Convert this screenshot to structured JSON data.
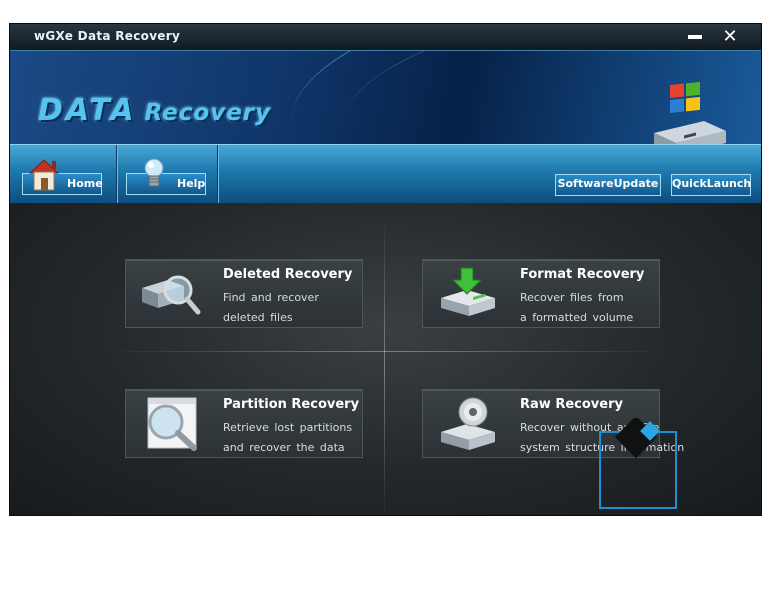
{
  "window": {
    "title": "wGXe Data Recovery",
    "minimize_icon": "minimize-icon",
    "close_icon": "close-icon",
    "close_glyph": "✕"
  },
  "banner": {
    "logo_part1": "DATA",
    "logo_part2": "Recovery",
    "logo_icon": "hard-drive-windows-logo"
  },
  "toolbar": {
    "home_label": "Home",
    "help_label": "Help",
    "update_label": "SoftwareUpdate",
    "quicklaunch_label": "QuickLaunch"
  },
  "cards": [
    {
      "title": "Deleted Recovery",
      "line1": "Find and recover",
      "line2": "deleted files",
      "icon": "drive-magnifier-icon"
    },
    {
      "title": "Format Recovery",
      "line1": "Recover files from",
      "line2": "a formatted volume",
      "icon": "drive-download-arrow-icon"
    },
    {
      "title": "Partition Recovery",
      "line1": "Retrieve lost partitions",
      "line2": "and recover the data",
      "icon": "window-magnifier-icon"
    },
    {
      "title": "Raw Recovery",
      "line1": "Recover without any file",
      "line2": "system structure information",
      "icon": "drive-disc-icon"
    }
  ],
  "colors": {
    "accent": "#57c3f0",
    "toolbar": "#1d78ad",
    "panel": "#23282b"
  }
}
